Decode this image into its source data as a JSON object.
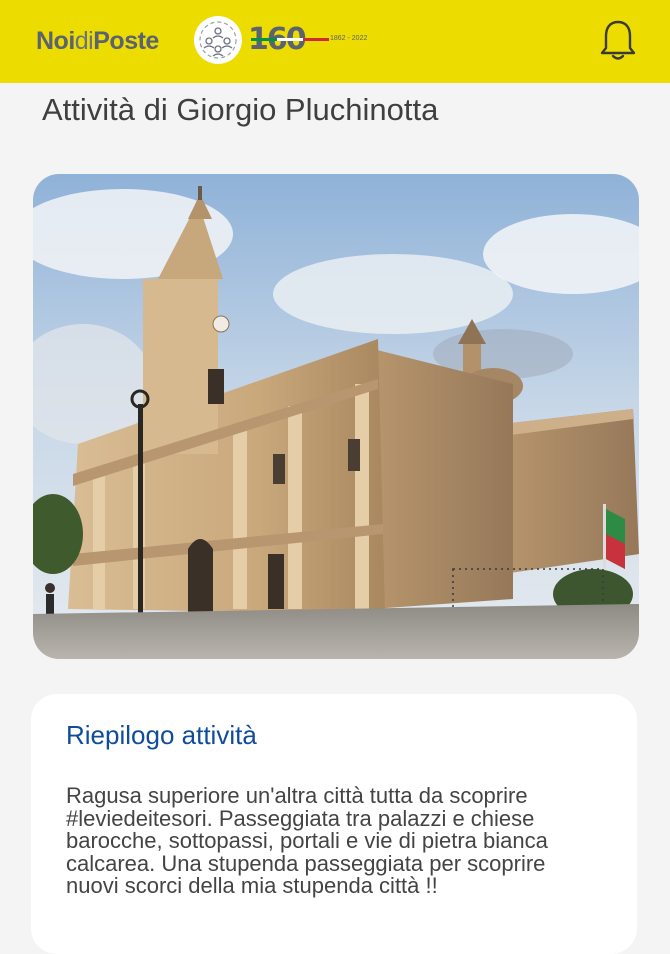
{
  "header": {
    "brand_bold_1": "Noi",
    "brand_light": "di",
    "brand_bold_2": "Poste",
    "anniversary_number": "160",
    "anniversary_years": "1862 - 2022",
    "icons": {
      "community": "community-icon",
      "notifications": "bell-icon"
    }
  },
  "page": {
    "title": "Attività di Giorgio Pluchinotta"
  },
  "photo": {
    "subject": "baroque-cathedral-photo"
  },
  "summary": {
    "title": "Riepilogo attività",
    "body": "Ragusa superiore un'altra città tutta da scoprire\n#leviedeitesori.  Passeggiata tra palazzi e chiese\nbarocche, sottopassi, portali e vie di pietra bianca\ncalcarea. Una stupenda passeggiata per scoprire\nnuovi scorci della mia stupenda città !!"
  },
  "colors": {
    "header_yellow": "#eddc00",
    "brand_grey": "#5b6370",
    "title_blue": "#0f4c9a",
    "flag_green": "#009246",
    "flag_red": "#ce2b37"
  }
}
